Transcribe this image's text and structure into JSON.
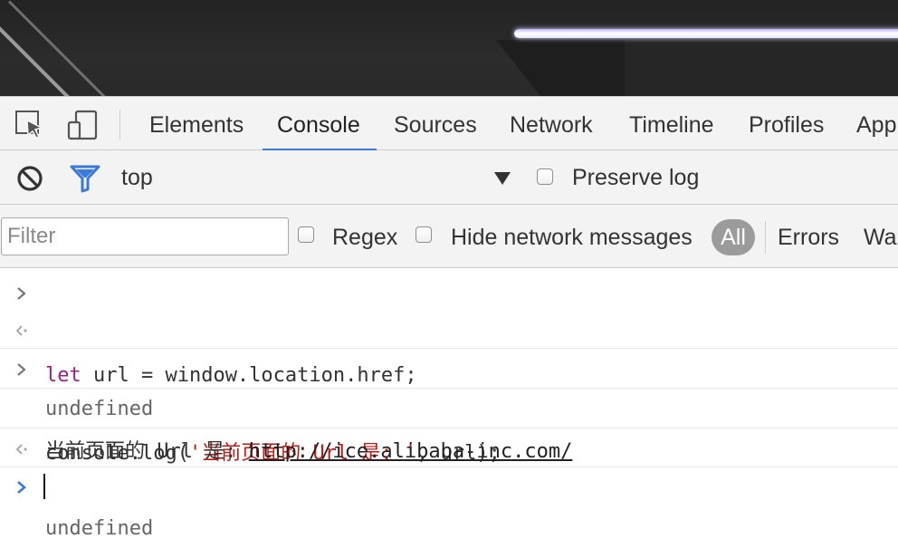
{
  "devtools": {
    "tabs": [
      "Elements",
      "Console",
      "Sources",
      "Network",
      "Timeline",
      "Profiles",
      "App"
    ],
    "active_tab": "Console"
  },
  "console_toolbar": {
    "context": "top",
    "preserve_log": "Preserve log"
  },
  "filter_bar": {
    "filter_placeholder": "Filter",
    "regex": "Regex",
    "hide_network": "Hide network messages",
    "levels": [
      "All",
      "Errors",
      "Wa"
    ]
  },
  "console": {
    "line1_kw": "let",
    "line1_rest": " url = window.location.href;",
    "line2": "undefined",
    "line3_pre": "console.log(",
    "line3_str": "'当前页面的 Url 是: '",
    "line3_post": ", url);",
    "line4_text": "当前页面的 Url 是: ",
    "line4_link": "http://ice.alibaba-inc.com/",
    "line5": "undefined"
  },
  "colors": {
    "accent": "#3879d9",
    "keyword": "#a11e8a",
    "string": "#c41a16"
  }
}
